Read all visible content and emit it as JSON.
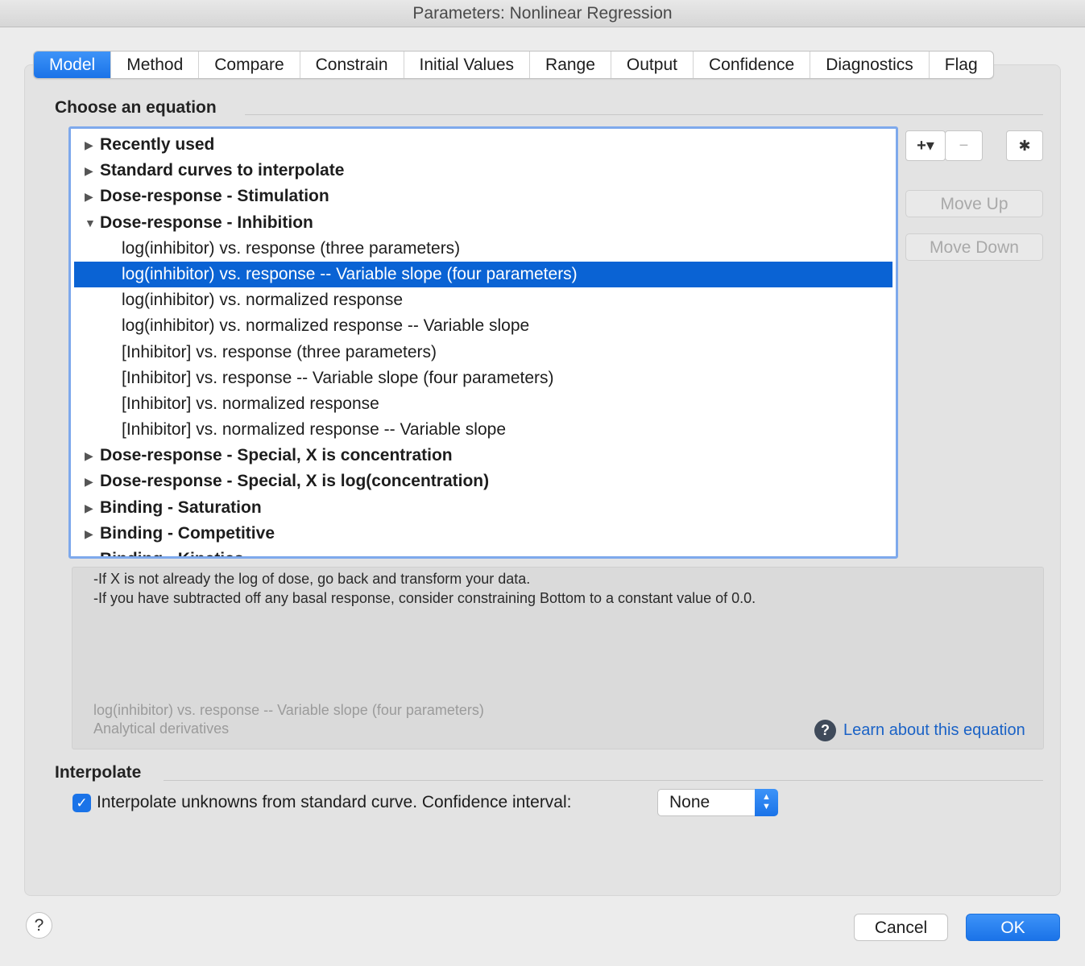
{
  "window": {
    "title": "Parameters: Nonlinear Regression"
  },
  "tabs": [
    {
      "label": "Model",
      "active": true
    },
    {
      "label": "Method"
    },
    {
      "label": "Compare"
    },
    {
      "label": "Constrain"
    },
    {
      "label": "Initial Values"
    },
    {
      "label": "Range"
    },
    {
      "label": "Output"
    },
    {
      "label": "Confidence"
    },
    {
      "label": "Diagnostics"
    },
    {
      "label": "Flag"
    }
  ],
  "equation": {
    "section_title": "Choose an equation",
    "list": [
      {
        "type": "group",
        "label": "Recently used",
        "expanded": false
      },
      {
        "type": "group",
        "label": "Standard curves to interpolate",
        "expanded": false
      },
      {
        "type": "group",
        "label": "Dose-response - Stimulation",
        "expanded": false
      },
      {
        "type": "group",
        "label": "Dose-response - Inhibition",
        "expanded": true
      },
      {
        "type": "item",
        "label": "log(inhibitor) vs. response (three parameters)"
      },
      {
        "type": "item",
        "label": "log(inhibitor) vs. response -- Variable slope (four parameters)",
        "selected": true
      },
      {
        "type": "item",
        "label": "log(inhibitor) vs. normalized response"
      },
      {
        "type": "item",
        "label": "log(inhibitor) vs. normalized response -- Variable slope"
      },
      {
        "type": "item",
        "label": "[Inhibitor] vs. response (three parameters)"
      },
      {
        "type": "item",
        "label": "[Inhibitor] vs. response -- Variable slope (four parameters)"
      },
      {
        "type": "item",
        "label": "[Inhibitor] vs. normalized response"
      },
      {
        "type": "item",
        "label": "[Inhibitor] vs. normalized response -- Variable slope"
      },
      {
        "type": "group",
        "label": "Dose-response - Special, X is concentration",
        "expanded": false
      },
      {
        "type": "group",
        "label": "Dose-response - Special, X is log(concentration)",
        "expanded": false
      },
      {
        "type": "group",
        "label": "Binding - Saturation",
        "expanded": false
      },
      {
        "type": "group",
        "label": "Binding - Competitive",
        "expanded": false
      },
      {
        "type": "group",
        "label": "Binding - Kinetics",
        "expanded": false
      }
    ],
    "toolbar": {
      "add_label": "+▾",
      "remove_label": "−",
      "settings_icon": "gear-icon",
      "settings_glyph": "✱"
    },
    "move_up_label": "Move Up",
    "move_down_label": "Move Down",
    "description": {
      "line1": "-If X is not already the log of dose, go back and transform your data.",
      "line2": "-If you have subtracted off any  basal response, consider constraining Bottom to a constant value of 0.0.",
      "equation_name": "log(inhibitor) vs. response -- Variable slope (four parameters)",
      "derivatives": "Analytical derivatives",
      "learn_label": "Learn about this equation"
    }
  },
  "interpolate": {
    "section_title": "Interpolate",
    "checkbox_checked": true,
    "checkbox_label": "Interpolate unknowns from standard curve. Confidence interval:",
    "ci_value": "None"
  },
  "footer": {
    "help_label": "?",
    "cancel_label": "Cancel",
    "ok_label": "OK"
  },
  "colors": {
    "accent": "#1a73e8",
    "selection": "#0a63d4",
    "link": "#1a62c6"
  }
}
